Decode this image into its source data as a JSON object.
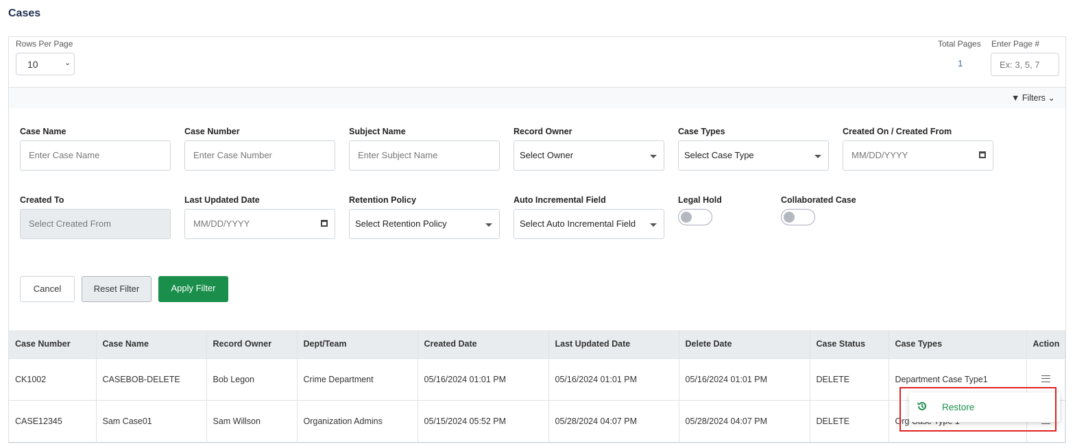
{
  "page": {
    "title": "Cases"
  },
  "pagination": {
    "rows_per_page_label": "Rows Per Page",
    "rows_per_page_value": "10",
    "total_pages_label": "Total Pages",
    "total_pages_value": "1",
    "enter_page_label": "Enter Page #",
    "enter_page_placeholder": "Ex: 3, 5, 7"
  },
  "filters": {
    "toggle_label": "Filters",
    "case_name": {
      "label": "Case Name",
      "placeholder": "Enter Case Name"
    },
    "case_number": {
      "label": "Case Number",
      "placeholder": "Enter Case Number"
    },
    "subject_name": {
      "label": "Subject Name",
      "placeholder": "Enter Subject Name"
    },
    "record_owner": {
      "label": "Record Owner",
      "value": "Select Owner"
    },
    "case_types": {
      "label": "Case Types",
      "value": "Select Case Type"
    },
    "created_from": {
      "label": "Created On / Created From",
      "placeholder": "MM/DD/YYYY"
    },
    "created_to": {
      "label": "Created To",
      "placeholder": "Select Created From"
    },
    "last_updated": {
      "label": "Last Updated Date",
      "placeholder": "MM/DD/YYYY"
    },
    "retention": {
      "label": "Retention Policy",
      "value": "Select Retention Policy"
    },
    "auto_inc": {
      "label": "Auto Incremental Field",
      "value": "Select Auto Incremental Field"
    },
    "legal_hold": {
      "label": "Legal Hold",
      "on": false
    },
    "collaborated": {
      "label": "Collaborated Case",
      "on": false
    },
    "cancel": "Cancel",
    "reset": "Reset Filter",
    "apply": "Apply Filter"
  },
  "table": {
    "headers": [
      "Case Number",
      "Case Name",
      "Record Owner",
      "Dept/Team",
      "Created Date",
      "Last Updated Date",
      "Delete Date",
      "Case Status",
      "Case Types",
      "Action"
    ],
    "rows": [
      [
        "CK1002",
        "CASEBOB-DELETE",
        "Bob Legon",
        "Crime Department",
        "05/16/2024 01:01 PM",
        "05/16/2024 01:01 PM",
        "05/16/2024 01:01 PM",
        "DELETE",
        "Department Case Type1"
      ],
      [
        "CASE12345",
        "Sam Case01",
        "Sam Willson",
        "Organization Admins",
        "05/15/2024 05:52 PM",
        "05/28/2024 04:07 PM",
        "05/28/2024 04:07 PM",
        "DELETE",
        "Org Case Type 1"
      ]
    ]
  },
  "action_menu": {
    "restore": "Restore"
  },
  "colors": {
    "accent": "#1a8f4c",
    "highlight": "#e02020",
    "title": "#1f2d4d"
  }
}
